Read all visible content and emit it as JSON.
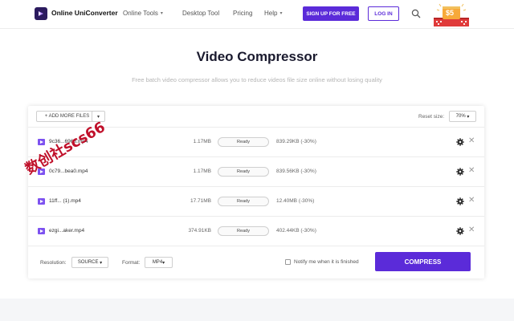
{
  "header": {
    "brand": "Online UniConverter",
    "nav": [
      {
        "label": "Online Tools",
        "caret": "▾"
      },
      {
        "label": "Desktop Tool"
      },
      {
        "label": "Pricing"
      },
      {
        "label": "Help",
        "caret": "▾"
      }
    ],
    "signup_label": "SIGN UP FOR FREE",
    "login_label": "LOG IN",
    "promo_amount": "$5"
  },
  "page": {
    "title": "Video Compressor",
    "subtitle": "Free batch video compressor allows you to reduce videos file size online without losing quality"
  },
  "toolbar": {
    "add_label": "+ ADD MORE FILES",
    "add_dropdown": "▾",
    "reset_label": "Reset size:",
    "reset_value": "70%",
    "reset_caret": "▾"
  },
  "files": [
    {
      "name": "9c36...6968.mp4",
      "size": "1.17MB",
      "status": "Ready",
      "new_size": "839.29KB (-30%)"
    },
    {
      "name": "0c79...bea0.mp4",
      "size": "1.17MB",
      "status": "Ready",
      "new_size": "839.56KB (-30%)"
    },
    {
      "name": "11ff... (1).mp4",
      "size": "17.71MB",
      "status": "Ready",
      "new_size": "12.40MB (-30%)"
    },
    {
      "name": "ezgi...aker.mp4",
      "size": "374.91KB",
      "status": "Ready",
      "new_size": "402.44KB (-30%)"
    }
  ],
  "footer": {
    "resolution_label": "Resolution:",
    "resolution_value": "SOURCE",
    "resolution_caret": "▾",
    "format_label": "Format:",
    "format_value": "MP4",
    "format_caret": "▾",
    "notify_label": "Notify me when it is finished",
    "compress_label": "COMPRESS"
  },
  "watermark": "数创社scs66",
  "colors": {
    "accent": "#5b2bd9",
    "file_icon": "#7d52f0",
    "watermark": "#c0102a"
  },
  "icons": {
    "search": "search-icon",
    "gear": "gear-icon",
    "close": "close-icon",
    "file": "video-file-icon",
    "checkbox": "checkbox-icon"
  }
}
